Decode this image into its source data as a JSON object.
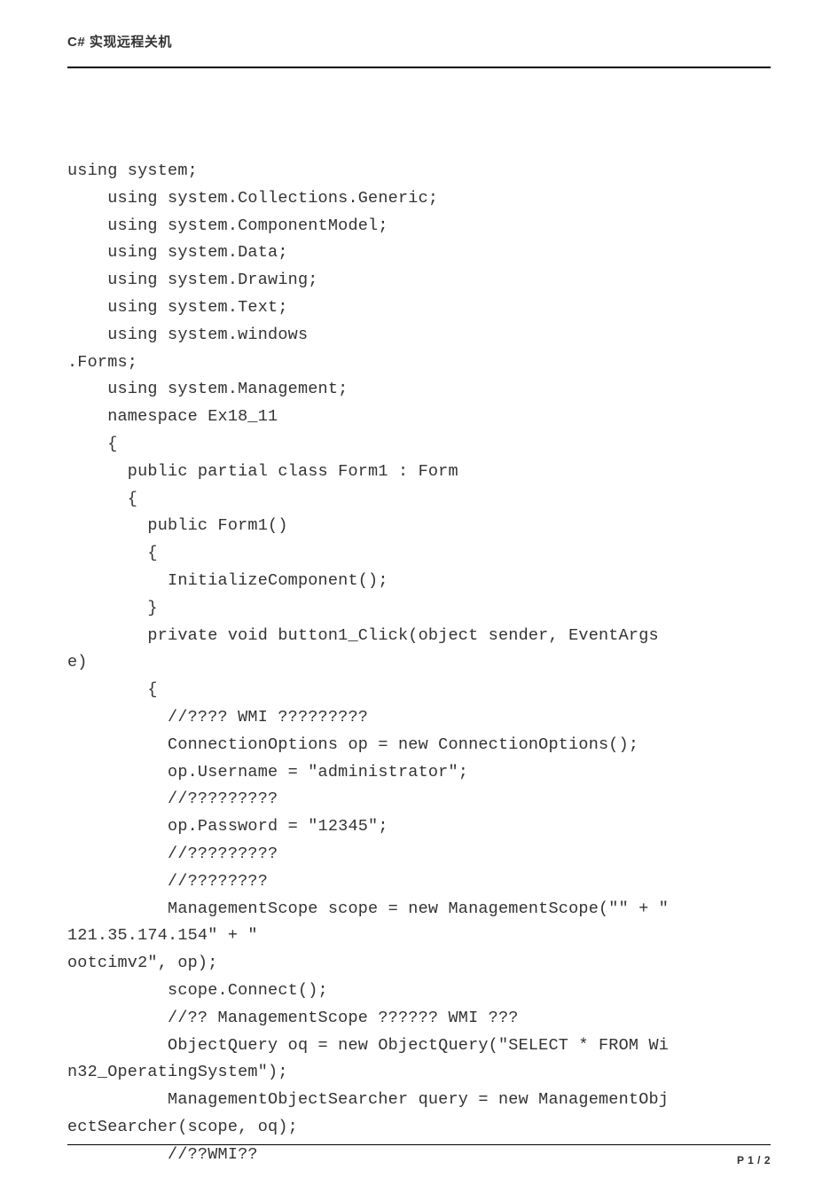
{
  "header": {
    "title": "C# 实现远程关机"
  },
  "code": {
    "lines": [
      "using system;",
      "    using system.Collections.Generic;",
      "    using system.ComponentModel;",
      "    using system.Data;",
      "    using system.Drawing;",
      "    using system.Text;",
      "    using system.windows",
      ".Forms;",
      "    using system.Management;",
      "    namespace Ex18_11",
      "    {",
      "      public partial class Form1 : Form",
      "      {",
      "        public Form1()",
      "        {",
      "          InitializeComponent();",
      "        }",
      "        private void button1_Click(object sender, EventArgs",
      "e)",
      "        {",
      "          //???? WMI ?????????",
      "          ConnectionOptions op = new ConnectionOptions();",
      "          op.Username = \"administrator\";",
      "          //?????????",
      "          op.Password = \"12345\";",
      "          //?????????",
      "          //????????",
      "          ManagementScope scope = new ManagementScope(\"\" + \"",
      "121.35.174.154\" + \"",
      "ootcimv2\", op);",
      "          scope.Connect();",
      "          //?? ManagementScope ?????? WMI ???",
      "          ObjectQuery oq = new ObjectQuery(\"SELECT * FROM Wi",
      "n32_OperatingSystem\");",
      "          ManagementObjectSearcher query = new ManagementObj",
      "ectSearcher(scope, oq);",
      "          //??WMI??"
    ]
  },
  "footer": {
    "page": "P 1 / 2"
  }
}
